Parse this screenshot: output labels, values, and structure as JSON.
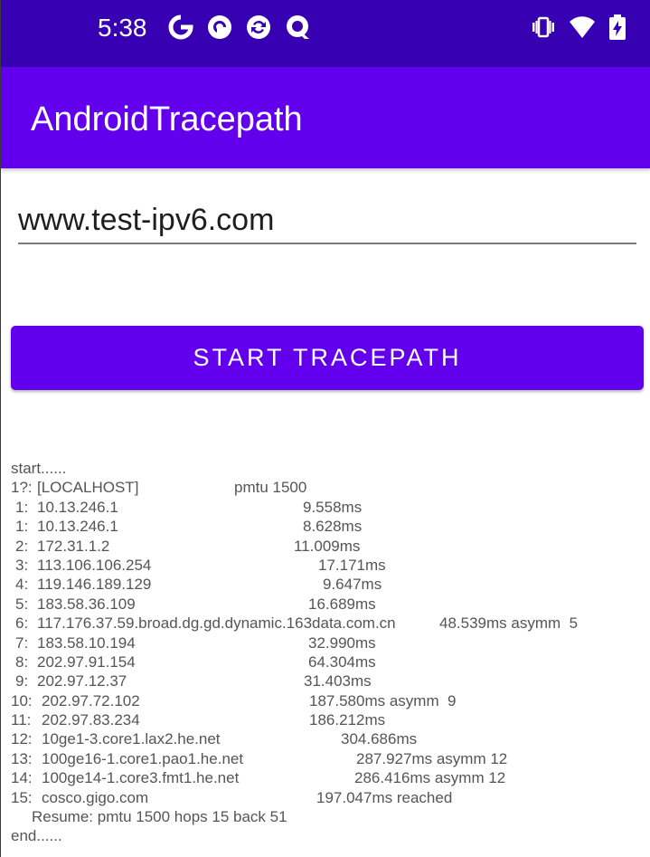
{
  "status_bar": {
    "time": "5:38",
    "left_icons": [
      "google-g-icon",
      "pocket-casts-icon",
      "sync-icon",
      "qlone-icon"
    ],
    "right_icons": [
      "vibrate-icon",
      "wifi-icon",
      "battery-charging-icon"
    ],
    "background": "#3700b3"
  },
  "app_bar": {
    "title": "AndroidTracepath",
    "background": "#6200ee"
  },
  "host_input": {
    "value": "www.test-ipv6.com"
  },
  "start_button": {
    "label": "START TRACEPATH",
    "color": "#6200ee"
  },
  "output": {
    "header": "start......",
    "hops": [
      {
        "hop": "1?:",
        "host": "[LOCALHOST]",
        "result": "pmtu 1500"
      },
      {
        "hop": "1:",
        "host": "10.13.246.1",
        "result": "9.558ms"
      },
      {
        "hop": "1:",
        "host": "10.13.246.1",
        "result": "8.628ms"
      },
      {
        "hop": "2:",
        "host": "172.31.1.2",
        "result": "11.009ms"
      },
      {
        "hop": "3:",
        "host": "113.106.106.254",
        "result": "17.171ms"
      },
      {
        "hop": "4:",
        "host": "119.146.189.129",
        "result": "9.647ms"
      },
      {
        "hop": "5:",
        "host": "183.58.36.109",
        "result": "16.689ms"
      },
      {
        "hop": "6:",
        "host": "117.176.37.59.broad.dg.gd.dynamic.163data.com.cn",
        "result": "48.539ms asymm  5"
      },
      {
        "hop": "7:",
        "host": "183.58.10.194",
        "result": "32.990ms"
      },
      {
        "hop": "8:",
        "host": "202.97.91.154",
        "result": "64.304ms"
      },
      {
        "hop": "9:",
        "host": "202.97.12.37",
        "result": "31.403ms"
      },
      {
        "hop": "10:",
        "host": "202.97.72.102",
        "result": "187.580ms asymm  9"
      },
      {
        "hop": "11:",
        "host": "202.97.83.234",
        "result": "186.212ms"
      },
      {
        "hop": "12:",
        "host": "10ge1-3.core1.lax2.he.net",
        "result": "304.686ms"
      },
      {
        "hop": "13:",
        "host": "100ge16-1.core1.pao1.he.net",
        "result": "287.927ms asymm 12"
      },
      {
        "hop": "14:",
        "host": "100ge14-1.core3.fmt1.he.net",
        "result": "286.416ms asymm 12"
      },
      {
        "hop": "15:",
        "host": "cosco.gigo.com",
        "result": "197.047ms reached"
      }
    ],
    "resume": "Resume: pmtu 1500 hops 15 back 51",
    "footer": "end......"
  }
}
